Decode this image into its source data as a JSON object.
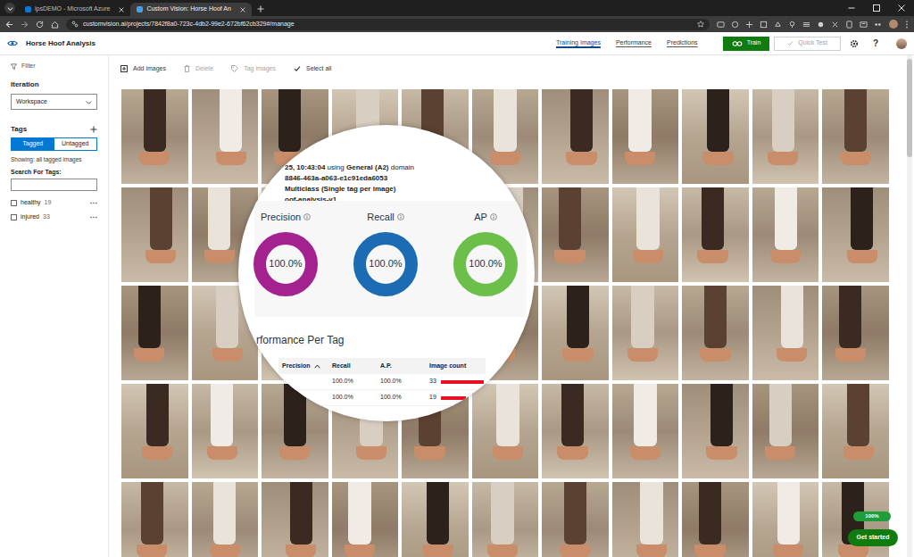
{
  "browser": {
    "tabs": [
      {
        "label": "lpsDEMO - Microsoft Azure",
        "selected": false
      },
      {
        "label": "Custom Vision: Horse Hoof An",
        "selected": true
      }
    ],
    "address": "customvision.ai/projects/7842f8a0-723c-4db2-99e2-672bf62cb329#/manage"
  },
  "app": {
    "title": "Horse Hoof Analysis",
    "nav": [
      {
        "label": "Training Images",
        "selected": true
      },
      {
        "label": "Performance",
        "selected": false
      },
      {
        "label": "Predictions",
        "selected": false
      }
    ],
    "train_button": "Train",
    "quick_test": {
      "label": "Quick Test",
      "disabled": true
    },
    "help": "?"
  },
  "sidebar": {
    "filter": "Filter",
    "iteration_label": "Iteration",
    "iteration_value": "Workspace",
    "tags_label": "Tags",
    "toggle": [
      {
        "label": "Tagged",
        "selected": true
      },
      {
        "label": "Untagged",
        "selected": false
      }
    ],
    "showing": "Showing: all tagged images",
    "search_label": "Search For Tags:",
    "tags": [
      {
        "name": "healthy",
        "count": "19",
        "checked": false
      },
      {
        "name": "injured",
        "count": "33",
        "checked": false
      }
    ]
  },
  "toolbar": [
    {
      "label": "Add images",
      "disabled": false
    },
    {
      "label": "Delete",
      "disabled": true
    },
    {
      "label": "Tag images",
      "disabled": true
    },
    {
      "label": "Select all",
      "disabled": false
    }
  ],
  "magnifier": {
    "info_lines": [
      [
        {
          "text": "25, 10:43:04",
          "bold": true
        },
        {
          "text": " using ",
          "bold": false
        },
        {
          "text": "General (A2)",
          "bold": true
        },
        {
          "text": " domain",
          "bold": false
        }
      ],
      [
        {
          "text": "8846-463a-a063-e1c91eda6053",
          "bold": true
        }
      ],
      [
        {
          "text": "Multiclass (Single tag per image)",
          "bold": true
        }
      ],
      [
        {
          "text": "oof-analysis-v1",
          "bold": true
        }
      ]
    ],
    "metrics": [
      {
        "label": "Precision",
        "value": "100.0%",
        "level": 1,
        "color": "#a3228f"
      },
      {
        "label": "Recall",
        "value": "100.0%",
        "level": 1,
        "color": "#1b6cb3"
      },
      {
        "label": "AP",
        "value": "100.0%",
        "level": 1,
        "color": "#6cc04a"
      }
    ],
    "per_tag_title": "rformance Per Tag",
    "columns": [
      "Precision",
      "Recall",
      "A.P.",
      "Image count"
    ],
    "rows": [
      {
        "recall": "100.0%",
        "ap": "100.0%",
        "count": "33",
        "level": 1
      },
      {
        "recall": "100.0%",
        "ap": "100.0%",
        "count": "19",
        "level": 0.58
      }
    ]
  },
  "widgets": {
    "badge": "100%",
    "get_started": "Get started"
  }
}
